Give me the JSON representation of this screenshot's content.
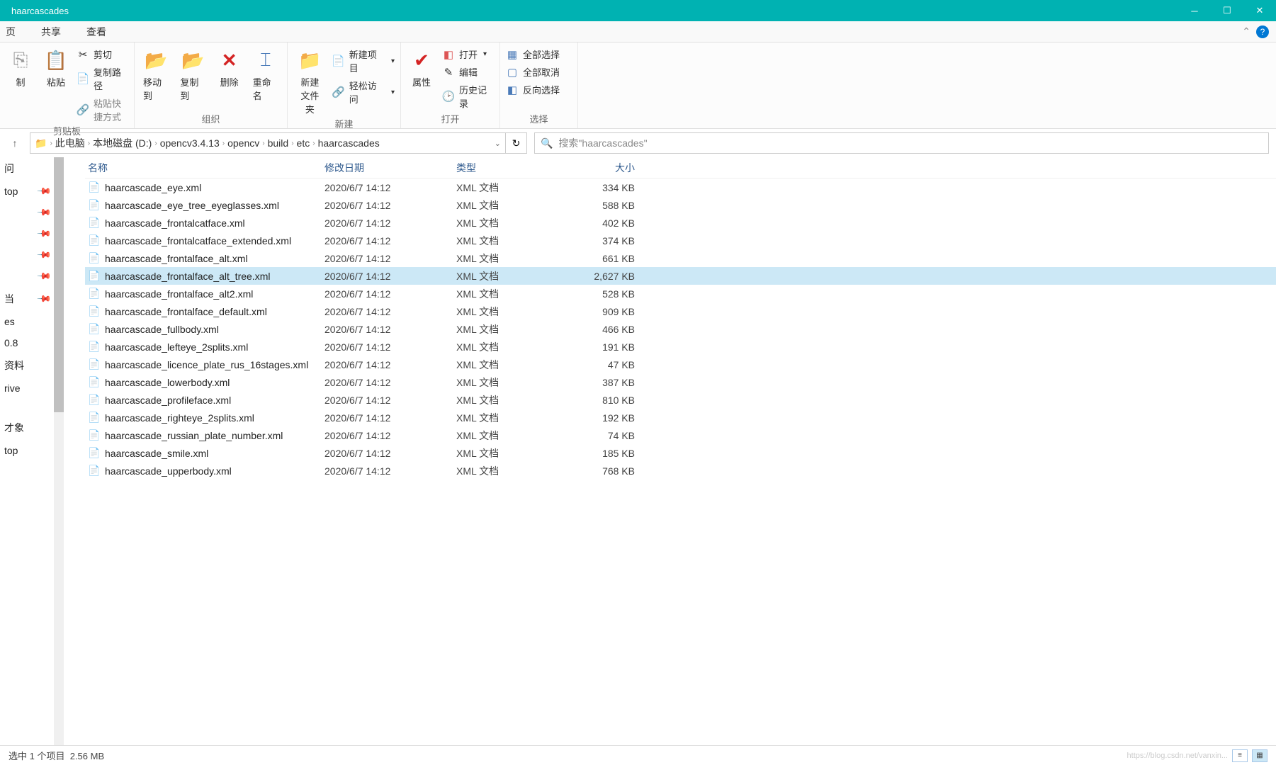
{
  "window": {
    "title": "haarcascades"
  },
  "tabs": {
    "home": "页",
    "share": "共享",
    "view": "查看"
  },
  "ribbon": {
    "clipboard": {
      "label": "剪贴板",
      "copy": "制",
      "paste": "粘贴",
      "cut": "剪切",
      "copyPath": "复制路径",
      "pasteShortcut": "粘贴快捷方式"
    },
    "organize": {
      "label": "组织",
      "moveTo": "移动到",
      "copyTo": "复制到",
      "delete": "删除",
      "rename": "重命名"
    },
    "new": {
      "label": "新建",
      "newFolder": "新建\n文件夹",
      "newItem": "新建项目",
      "easyAccess": "轻松访问"
    },
    "open": {
      "label": "打开",
      "properties": "属性",
      "open": "打开",
      "edit": "编辑",
      "history": "历史记录"
    },
    "select": {
      "label": "选择",
      "selectAll": "全部选择",
      "selectNone": "全部取消",
      "invert": "反向选择"
    }
  },
  "breadcrumb": {
    "root": "此电脑",
    "drive": "本地磁盘 (D:)",
    "p1": "opencv3.4.13",
    "p2": "opencv",
    "p3": "build",
    "p4": "etc",
    "p5": "haarcascades"
  },
  "search": {
    "placeholder": "搜索\"haarcascades\""
  },
  "columns": {
    "name": "名称",
    "date": "修改日期",
    "type": "类型",
    "size": "大小"
  },
  "nav": {
    "i0": "问",
    "i1": "top",
    "i2": "",
    "i3": "",
    "i4": "",
    "i5": "",
    "i6": "当",
    "i7": "es",
    "i8": "0.8",
    "i9": "资料",
    "i10": "rive",
    "i11": "才象",
    "i12": "top"
  },
  "fileType": "XML 文档",
  "files": [
    {
      "name": "haarcascade_eye.xml",
      "date": "2020/6/7 14:12",
      "size": "334 KB",
      "selected": false
    },
    {
      "name": "haarcascade_eye_tree_eyeglasses.xml",
      "date": "2020/6/7 14:12",
      "size": "588 KB",
      "selected": false
    },
    {
      "name": "haarcascade_frontalcatface.xml",
      "date": "2020/6/7 14:12",
      "size": "402 KB",
      "selected": false
    },
    {
      "name": "haarcascade_frontalcatface_extended.xml",
      "date": "2020/6/7 14:12",
      "size": "374 KB",
      "selected": false
    },
    {
      "name": "haarcascade_frontalface_alt.xml",
      "date": "2020/6/7 14:12",
      "size": "661 KB",
      "selected": false
    },
    {
      "name": "haarcascade_frontalface_alt_tree.xml",
      "date": "2020/6/7 14:12",
      "size": "2,627 KB",
      "selected": true
    },
    {
      "name": "haarcascade_frontalface_alt2.xml",
      "date": "2020/6/7 14:12",
      "size": "528 KB",
      "selected": false
    },
    {
      "name": "haarcascade_frontalface_default.xml",
      "date": "2020/6/7 14:12",
      "size": "909 KB",
      "selected": false
    },
    {
      "name": "haarcascade_fullbody.xml",
      "date": "2020/6/7 14:12",
      "size": "466 KB",
      "selected": false
    },
    {
      "name": "haarcascade_lefteye_2splits.xml",
      "date": "2020/6/7 14:12",
      "size": "191 KB",
      "selected": false
    },
    {
      "name": "haarcascade_licence_plate_rus_16stages.xml",
      "date": "2020/6/7 14:12",
      "size": "47 KB",
      "selected": false
    },
    {
      "name": "haarcascade_lowerbody.xml",
      "date": "2020/6/7 14:12",
      "size": "387 KB",
      "selected": false
    },
    {
      "name": "haarcascade_profileface.xml",
      "date": "2020/6/7 14:12",
      "size": "810 KB",
      "selected": false
    },
    {
      "name": "haarcascade_righteye_2splits.xml",
      "date": "2020/6/7 14:12",
      "size": "192 KB",
      "selected": false
    },
    {
      "name": "haarcascade_russian_plate_number.xml",
      "date": "2020/6/7 14:12",
      "size": "74 KB",
      "selected": false
    },
    {
      "name": "haarcascade_smile.xml",
      "date": "2020/6/7 14:12",
      "size": "185 KB",
      "selected": false
    },
    {
      "name": "haarcascade_upperbody.xml",
      "date": "2020/6/7 14:12",
      "size": "768 KB",
      "selected": false
    }
  ],
  "status": {
    "selection": "选中 1 个项目",
    "size": "2.56 MB",
    "watermark": "https://blog.csdn.net/vanxin..."
  }
}
